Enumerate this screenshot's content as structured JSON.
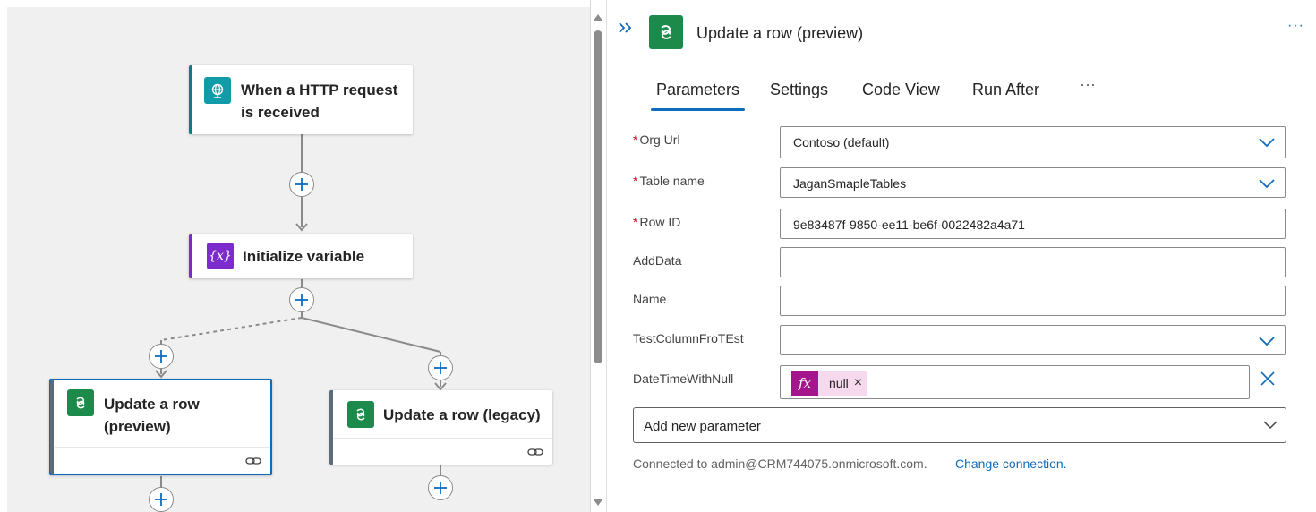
{
  "canvas": {
    "nodes": [
      {
        "title_line1": "When a HTTP request",
        "title_line2": "is received",
        "icon": "globe-request-icon",
        "accent": "#0f7b86"
      },
      {
        "title": "Initialize variable",
        "icon": "variable-icon",
        "accent": "#7c2bcc"
      },
      {
        "title_line1": "Update a row",
        "title_line2": "(preview)",
        "icon": "dataverse-icon",
        "accent": "#1b8a4a"
      },
      {
        "title": "Update a row (legacy)",
        "icon": "dataverse-icon",
        "accent": "#1b8a4a"
      }
    ]
  },
  "panel": {
    "title": "Update a row (preview)",
    "more": "···",
    "tabs": [
      "Parameters",
      "Settings",
      "Code View",
      "Run After"
    ],
    "tabs_more": "···",
    "active_tab": "Parameters",
    "fields": {
      "org_url": {
        "label": "Org Url",
        "required": "*",
        "value": "Contoso (default)"
      },
      "table_name": {
        "label": "Table name",
        "required": "*",
        "value": "JaganSmapleTables"
      },
      "row_id": {
        "label": "Row ID",
        "required": "*",
        "value": "9e83487f-9850-ee11-be6f-0022482a4a71"
      },
      "add_data": {
        "label": "AddData",
        "value": ""
      },
      "name": {
        "label": "Name",
        "value": ""
      },
      "test_column": {
        "label": "TestColumnFroTEst",
        "value": ""
      },
      "date_time": {
        "label": "DateTimeWithNull",
        "token_fx": "fx",
        "token_value": "null",
        "token_remove": "×"
      }
    },
    "add_parameter": "Add new parameter",
    "connected_text": "Connected to admin@CRM744075.onmicrosoft.com.",
    "change_connection": "Change connection."
  },
  "colors": {
    "accent_blue": "#0f6cbd",
    "dataverse_green": "#1b8a4a",
    "variable_purple": "#7c2bcc",
    "http_teal": "#0f7b86",
    "fx_magenta": "#a5168d",
    "required_red": "#c50f1f"
  }
}
